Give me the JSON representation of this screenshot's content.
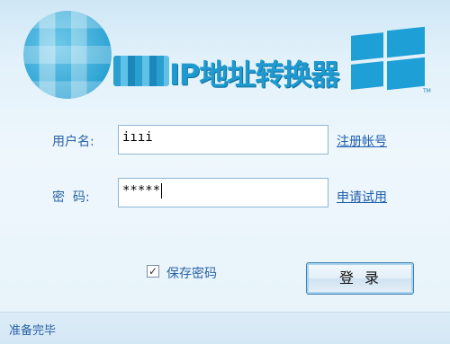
{
  "banner": {
    "title": "IP地址转换器",
    "trademark": "TM"
  },
  "form": {
    "username_label": "用户名:",
    "username_value": "iııi",
    "register_link": "注册帐号",
    "password_label": "密  码:",
    "password_value": "*****",
    "trial_link": "申请试用",
    "remember_label": "保存密码",
    "remember_checked": "✓",
    "login_label": "登录"
  },
  "status": {
    "text": "准备完毕"
  },
  "colors": {
    "accent": "#1f9ad0",
    "label": "#2a63a8",
    "link": "#1f5fae"
  }
}
